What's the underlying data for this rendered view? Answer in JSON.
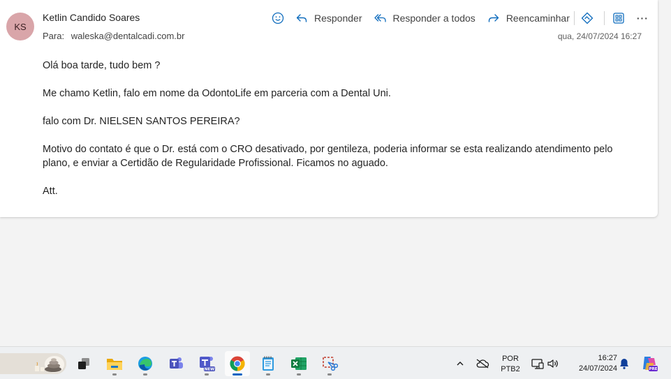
{
  "email": {
    "avatar_initials": "KS",
    "sender": "Ketlin Candido Soares",
    "to_label": "Para:",
    "to_value": "waleska@dentalcadi.com.br",
    "date": "qua, 24/07/2024 16:27",
    "body": [
      "Olá boa tarde, tudo bem ?",
      "Me chamo Ketlin, falo em nome da OdontoLife em parceria com a Dental Uni.",
      "falo com Dr. NIELSEN SANTOS PEREIRA?",
      "Motivo do contato é que o Dr. está com o CRO desativado, por gentileza, poderia informar se esta realizando atendimento pelo plano, e enviar a Certidão de Regularidade Profissional. Ficamos no aguado.",
      "Att."
    ]
  },
  "toolbar": {
    "reply": "Responder",
    "reply_all": "Responder a todos",
    "forward": "Reencaminhar",
    "more": "···"
  },
  "taskbar": {
    "language": "POR",
    "keyboard": "PTB2",
    "time": "16:27",
    "date": "24/07/2024",
    "apps": [
      "task-view",
      "file-explorer",
      "edge",
      "teams",
      "teams-new",
      "chrome",
      "notepad",
      "excel",
      "snipping-tool"
    ]
  },
  "colors": {
    "accent": "#0f6cbd",
    "avatar_bg": "#d9a5a9"
  }
}
